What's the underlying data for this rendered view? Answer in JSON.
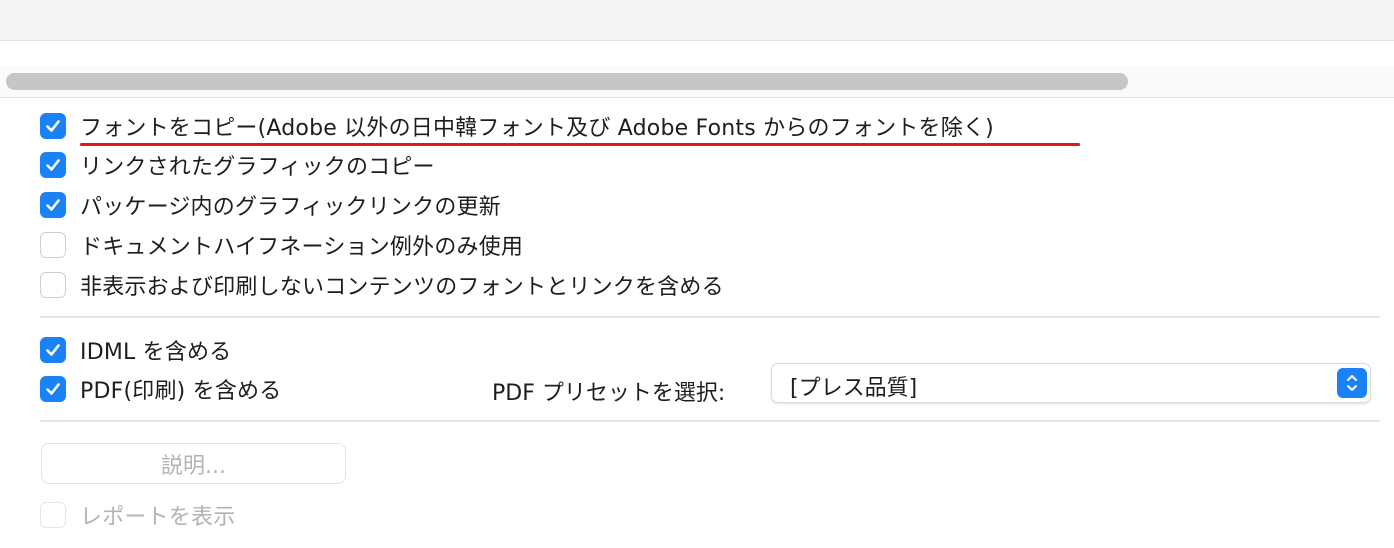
{
  "options": [
    {
      "label": "フォントをコピー(Adobe 以外の日中韓フォント及び Adobe Fonts からのフォントを除く)",
      "checked": true
    },
    {
      "label": "リンクされたグラフィックのコピー",
      "checked": true
    },
    {
      "label": "パッケージ内のグラフィックリンクの更新",
      "checked": true
    },
    {
      "label": "ドキュメントハイフネーション例外のみ使用",
      "checked": false
    },
    {
      "label": "非表示および印刷しないコンテンツのフォントとリンクを含める",
      "checked": false
    }
  ],
  "include": [
    {
      "label": "IDML を含める",
      "checked": true
    },
    {
      "label": "PDF(印刷) を含める",
      "checked": true
    }
  ],
  "pdf_preset": {
    "label": "PDF プリセットを選択:",
    "value": "[プレス品質]"
  },
  "description_button": "説明...",
  "report": {
    "label": "レポートを表示",
    "checked": false,
    "disabled": true
  },
  "colors": {
    "accent": "#1a82f5",
    "highlight_underline": "#e0171d"
  }
}
